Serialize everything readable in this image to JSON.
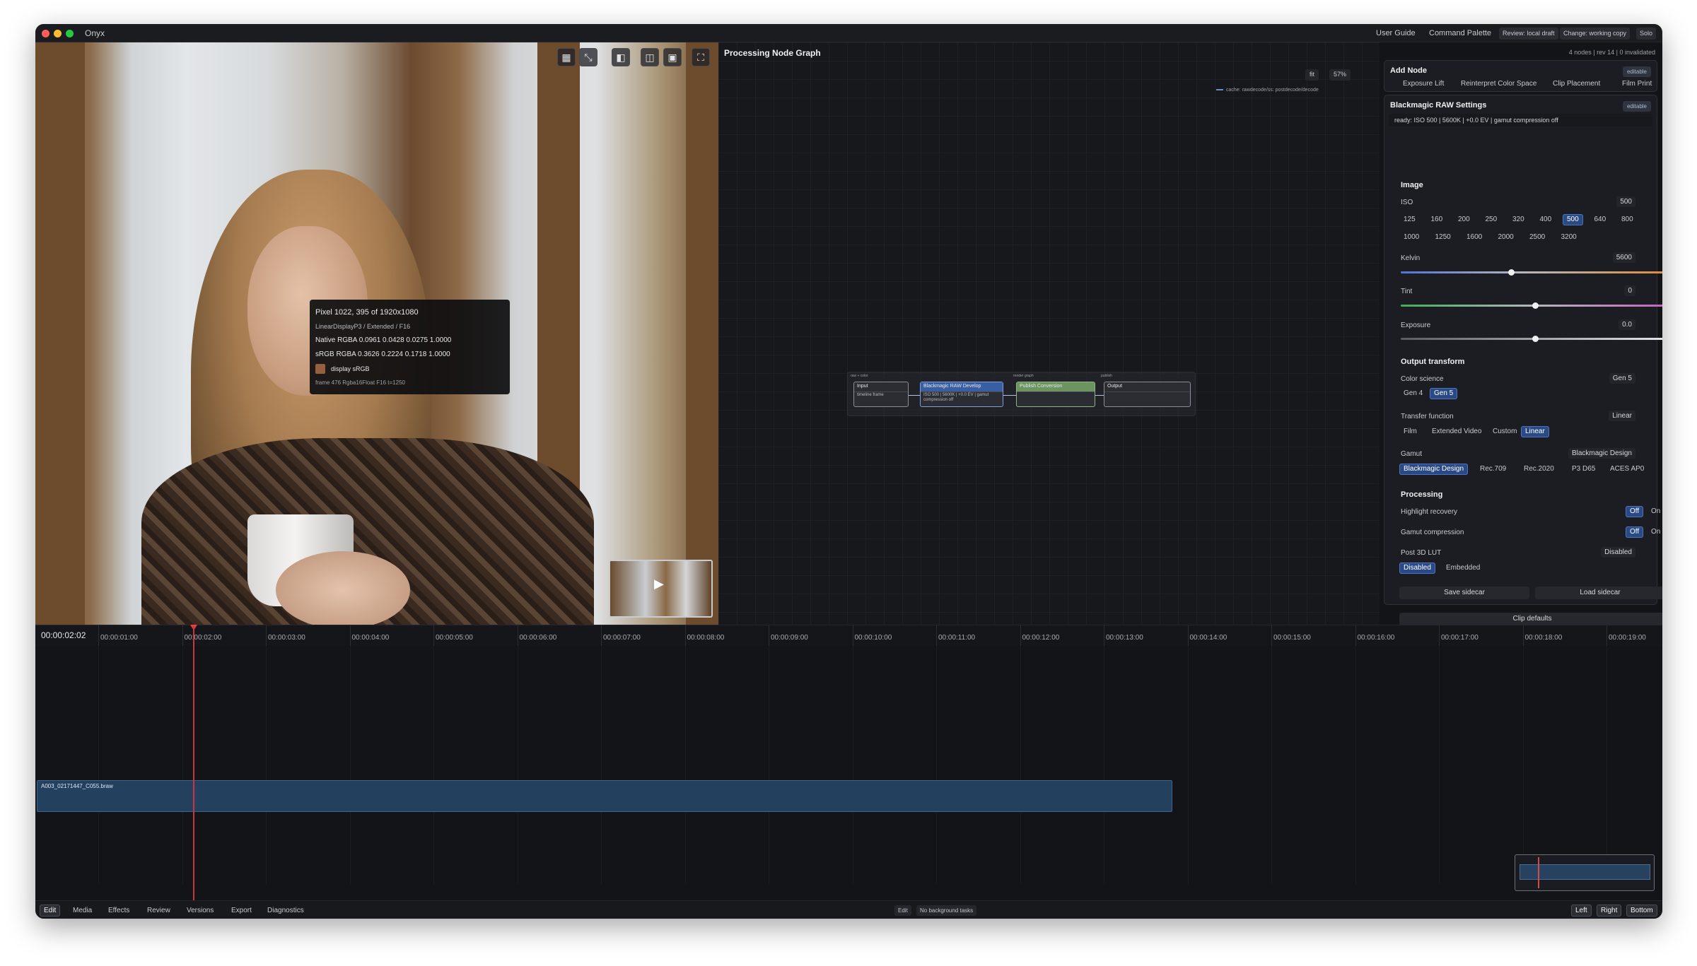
{
  "app": {
    "title": "Onyx"
  },
  "titlebar": {
    "buttons": [
      "User Guide",
      "Command Palette"
    ],
    "pills": [
      "Review: local draft",
      "Change: working copy",
      "Solo"
    ],
    "colors": {
      "close": "#ff5f57",
      "minimize": "#febc2e",
      "zoom": "#28c840"
    }
  },
  "viewer": {
    "tools": [
      "grid-icon",
      "fit-screen-icon",
      "compare-icon",
      "split-icon",
      "overlay-icon",
      "fullscreen-icon"
    ],
    "pixel_info": {
      "title": "Pixel 1022, 395 of 1920x1080",
      "space": "LinearDisplayP3 / Extended / F16",
      "native": "Native RGBA 0.0961  0.0428  0.0275  1.0000",
      "srgb": "sRGB RGBA 0.3626  0.2224  0.1718  1.0000",
      "display": "display sRGB",
      "frame": "frame 476  Rgba16Float  F16  t=1250",
      "swatch_color": "#94603f"
    }
  },
  "graph": {
    "title": "Processing Node Graph",
    "summary": "4 nodes | rev 14 | 0 invalidated",
    "zoom": {
      "fit_label": "fit",
      "percent": "57%"
    },
    "cache": "cache: rawdecode/ss: postdecode/decode",
    "groups": [
      "raw + color",
      "render graph",
      "publish"
    ],
    "nodes": [
      {
        "title": "Input",
        "body": "timeline frame"
      },
      {
        "title": "Blackmagic RAW Develop",
        "body": "ISO 500 | 5600K | +0.0 EV | gamut compression off"
      },
      {
        "title": "Publish Conversion",
        "body": ""
      },
      {
        "title": "Output",
        "body": ""
      }
    ]
  },
  "add_node": {
    "title": "Add Node",
    "badge": "editable",
    "items": [
      "Exposure Lift",
      "Reinterpret Color Space",
      "Clip Placement",
      "Film Print"
    ]
  },
  "raw_settings": {
    "title": "Blackmagic RAW Settings",
    "badge": "editable",
    "status": "ready: ISO 500 | 5600K | +0.0 EV | gamut compression off",
    "image": {
      "section": "Image",
      "iso_label": "ISO",
      "iso_value": "500",
      "iso_options": [
        "125",
        "160",
        "200",
        "250",
        "320",
        "400",
        "500",
        "640",
        "800",
        "1000",
        "1250",
        "1600",
        "2000",
        "2500",
        "3200"
      ],
      "iso_selected": "500",
      "kelvin_label": "Kelvin",
      "kelvin_value": "5600",
      "kelvin_level": 0.41,
      "tint_label": "Tint",
      "tint_value": "0",
      "tint_level": 0.5,
      "exposure_label": "Exposure",
      "exposure_value": "0.0",
      "exposure_level": 0.5
    },
    "output": {
      "section": "Output transform",
      "color_science_label": "Color science",
      "color_science_value": "Gen 5",
      "color_science_options": [
        "Gen 4",
        "Gen 5"
      ],
      "transfer_label": "Transfer function",
      "transfer_value": "Linear",
      "transfer_options": [
        "Film",
        "Extended Video",
        "Custom",
        "Linear"
      ],
      "gamut_label": "Gamut",
      "gamut_value": "Blackmagic Design",
      "gamut_options": [
        "Blackmagic Design",
        "Rec.709",
        "Rec.2020",
        "P3 D65",
        "ACES AP0"
      ]
    },
    "processing": {
      "section": "Processing",
      "highlight_label": "Highlight recovery",
      "gamut_comp_label": "Gamut compression",
      "toggle_off": "Off",
      "toggle_on": "On",
      "lut_label": "Post 3D LUT",
      "lut_value": "Disabled",
      "lut_options": [
        "Disabled",
        "Embedded"
      ]
    },
    "actions": {
      "save": "Save sidecar",
      "load": "Load sidecar",
      "defaults": "Clip defaults"
    }
  },
  "timeline": {
    "timecode": "00:00:02:02",
    "ticks": [
      "00:00:01:00",
      "00:00:02:00",
      "00:00:03:00",
      "00:00:04:00",
      "00:00:05:00",
      "00:00:06:00",
      "00:00:07:00",
      "00:00:08:00",
      "00:00:09:00",
      "00:00:10:00",
      "00:00:11:00",
      "00:00:12:00",
      "00:00:13:00",
      "00:00:14:00",
      "00:00:15:00",
      "00:00:16:00",
      "00:00:17:00",
      "00:00:18:00",
      "00:00:19:00"
    ],
    "clip_name": "A003_02171447_C055.braw"
  },
  "bottombar": {
    "tabs": [
      "Edit",
      "Media",
      "Effects",
      "Review",
      "Versions",
      "Export",
      "Diagnostics"
    ],
    "active_tab": "Edit",
    "status_mode": "Edit",
    "status_tasks": "No background tasks",
    "panels": [
      "Left",
      "Right",
      "Bottom"
    ]
  }
}
